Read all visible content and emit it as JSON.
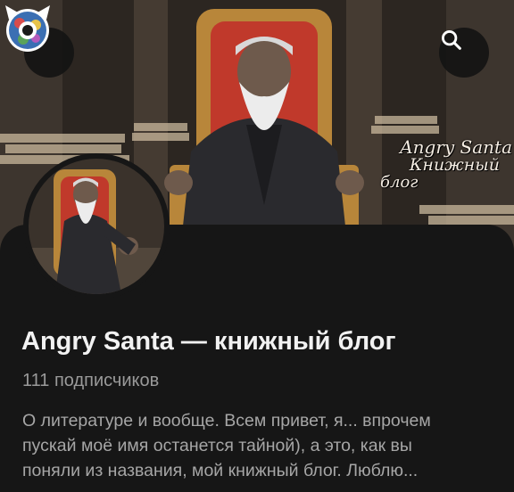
{
  "header": {
    "back_icon": "arrow-left-icon",
    "search_icon": "search-icon",
    "cover_caption": [
      "Angry Santa",
      "Книжный",
      "блог"
    ]
  },
  "channel": {
    "title": "Angry Santa — книжный блог",
    "subscribers": "111 подписчиков",
    "description_lines": [
      "О литературе и вообще. Всем привет, я... впрочем",
      "пускай моё имя останется тайной), а это, как вы",
      "поняли из названия, мой книжный блог. Люблю..."
    ]
  },
  "colors": {
    "background": "#161616",
    "title": "#f2f2f2",
    "secondary_text": "#9a9a9a",
    "button_bg": "#141414"
  }
}
